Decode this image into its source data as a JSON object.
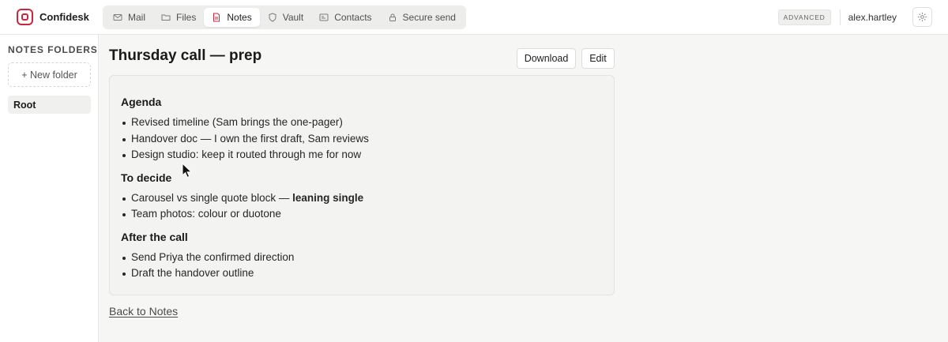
{
  "app": {
    "name": "Confidesk",
    "accent": "#c8283e"
  },
  "nav": [
    {
      "label": "Mail",
      "icon": "mail-icon",
      "active": false
    },
    {
      "label": "Files",
      "icon": "folder-icon",
      "active": false
    },
    {
      "label": "Notes",
      "icon": "note-icon",
      "active": true
    },
    {
      "label": "Vault",
      "icon": "shield-icon",
      "active": false
    },
    {
      "label": "Contacts",
      "icon": "contact-card-icon",
      "active": false
    },
    {
      "label": "Secure send",
      "icon": "lock-icon",
      "active": false
    }
  ],
  "header": {
    "badge": "ADVANCED",
    "username": "alex.hartley",
    "settings_icon": "gear-icon"
  },
  "sidebar": {
    "title": "NOTES FOLDERS",
    "new_folder": "+ New folder",
    "folders": [
      {
        "label": "Root",
        "selected": true
      }
    ]
  },
  "note": {
    "title": "Thursday call — prep",
    "download_label": "Download",
    "edit_label": "Edit",
    "sections": [
      {
        "heading": "Agenda",
        "items": [
          "Revised timeline (Sam brings the one-pager)",
          "Handover doc — I own the first draft, Sam reviews",
          "Design studio: keep it routed through me for now"
        ]
      },
      {
        "heading": "To decide",
        "items": [
          {
            "text": "Carousel vs single quote block — ",
            "bold": "leaning single"
          },
          "Team photos: colour or duotone"
        ]
      },
      {
        "heading": "After the call",
        "items": [
          "Send Priya the confirmed direction",
          "Draft the handover outline"
        ]
      }
    ]
  },
  "back_link": "Back to Notes"
}
